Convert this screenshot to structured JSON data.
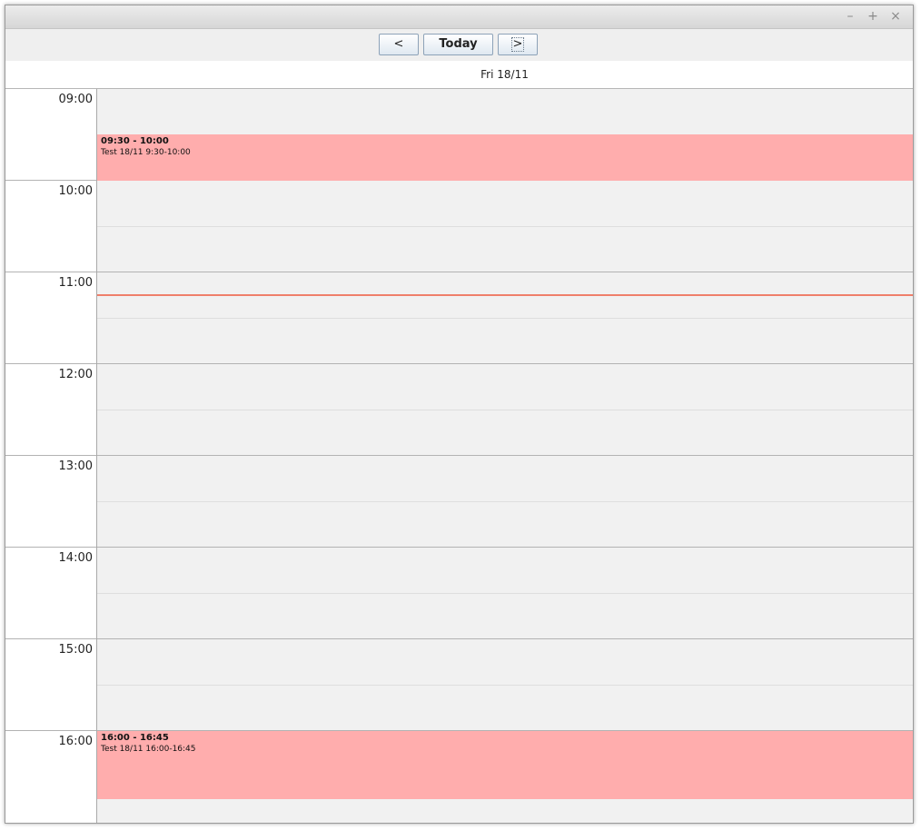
{
  "window": {
    "controls": {
      "minimize": "–",
      "maximize": "+",
      "close": "×"
    }
  },
  "toolbar": {
    "prev_label": "<",
    "today_label": "Today",
    "next_label": ">"
  },
  "day_header": {
    "label": "Fri 18/11"
  },
  "hours": [
    "09:00",
    "10:00",
    "11:00",
    "12:00",
    "13:00",
    "14:00",
    "15:00",
    "16:00"
  ],
  "current_time_marker": {
    "time": "11:15",
    "color": "#ef7f6a"
  },
  "events": [
    {
      "time": "09:30 - 10:00",
      "title": "Test 18/11 9:30-10:00",
      "start": "09:30",
      "end": "10:00"
    },
    {
      "time": "16:00 - 16:45",
      "title": "Test 18/11 16:00-16:45",
      "start": "16:00",
      "end": "16:45"
    }
  ],
  "colors": {
    "event_bg": "#ffadad",
    "grid_bg": "#f1f1f1",
    "button_border": "#8da2b8"
  }
}
